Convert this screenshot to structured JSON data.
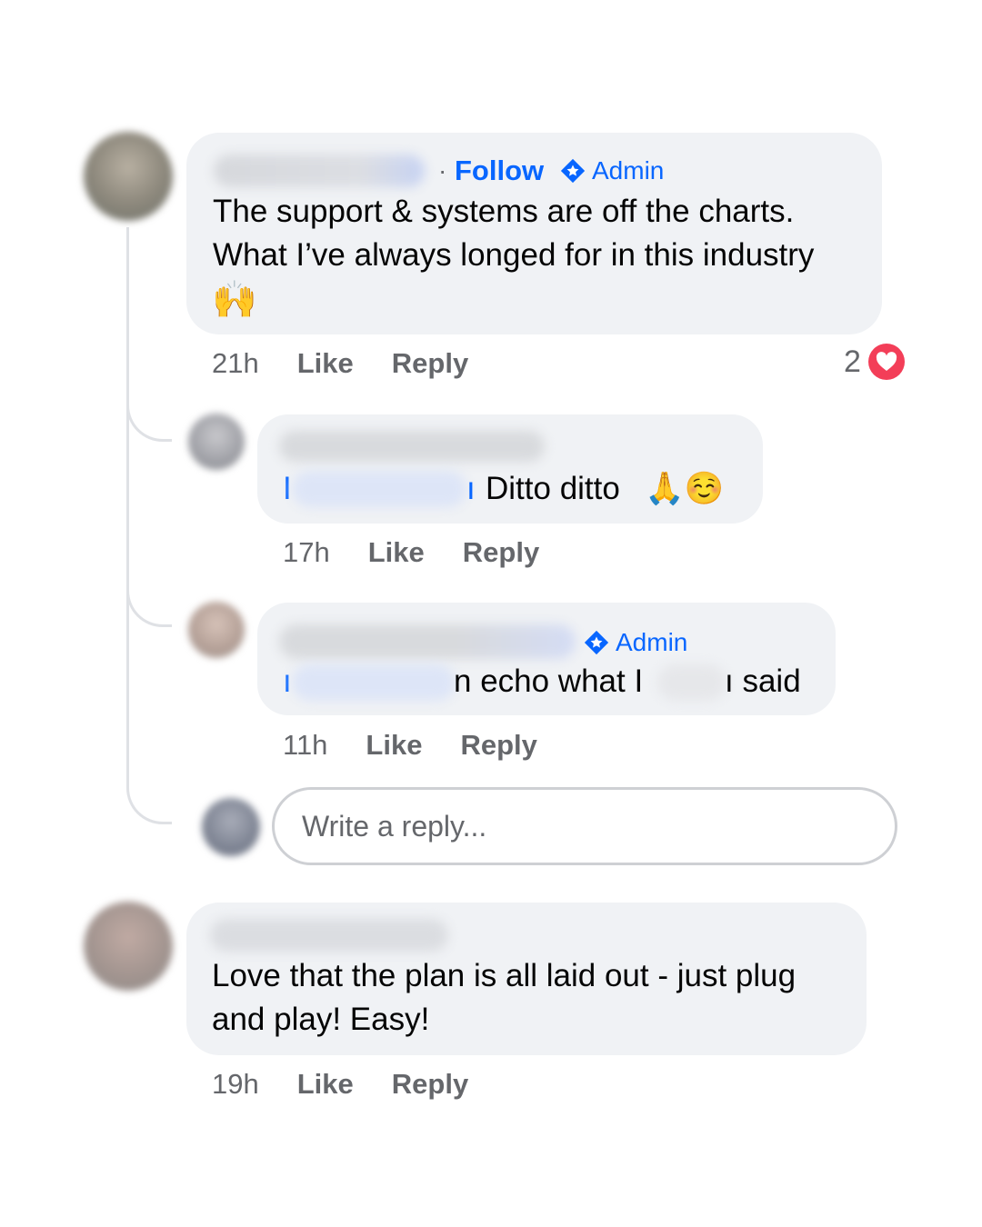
{
  "comments": [
    {
      "follow_label": "Follow",
      "dot": "·",
      "admin_label": "Admin",
      "text_line1": "The support & systems are off the charts.",
      "text_line2": "What I’ve always longed for in this industry",
      "emoji": "🙌",
      "time": "21h",
      "like_label": "Like",
      "reply_label": "Reply",
      "reaction_count": "2",
      "replies": [
        {
          "mention_visible": "I",
          "mention_tail": "ı",
          "text": "Ditto ditto",
          "emojis": "🙏☺️",
          "time": "17h",
          "like_label": "Like",
          "reply_label": "Reply"
        },
        {
          "admin_label": "Admin",
          "mention_visible": "ı",
          "text_mid": "n echo what I",
          "text_tail": "ı said",
          "time": "11h",
          "like_label": "Like",
          "reply_label": "Reply"
        }
      ],
      "reply_placeholder": "Write a reply..."
    },
    {
      "text_line1": "Love that the plan is all laid out - just plug",
      "text_line2": "and play! Easy!",
      "time": "19h",
      "like_label": "Like",
      "reply_label": "Reply"
    }
  ],
  "colors": {
    "accent": "#0866ff",
    "bubble": "#f0f2f5",
    "meta": "#65676b",
    "heart": "#f33e58"
  }
}
